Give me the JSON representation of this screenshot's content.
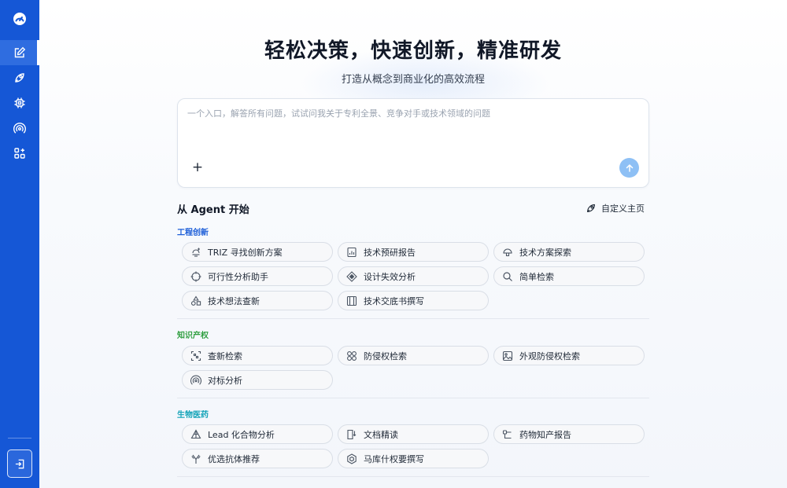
{
  "hero": {
    "title": "轻松决策，快速创新，精准研发",
    "subtitle": "打造从概念到商业化的高效流程"
  },
  "input": {
    "placeholder": "一个入口，解答所有问题，试试问我关于专利全景、竞争对手或技术领域的问题",
    "plus": "+"
  },
  "agents_header": {
    "title": "从 Agent 开始",
    "customize_label": "自定义主页"
  },
  "groups": [
    {
      "label": "工程创新",
      "color": "#1e5fd8",
      "items": [
        {
          "label": "TRIZ 寻找创新方案",
          "icon": "bulb-icon"
        },
        {
          "label": "技术预研报告",
          "icon": "chart-report-icon"
        },
        {
          "label": "技术方案探索",
          "icon": "helmet-icon"
        },
        {
          "label": "可行性分析助手",
          "icon": "target-icon"
        },
        {
          "label": "设计失效分析",
          "icon": "diamond-icon"
        },
        {
          "label": "简单检索",
          "icon": "search-icon"
        },
        {
          "label": "技术想法查新",
          "icon": "shapes-icon"
        },
        {
          "label": "技术交底书撰写",
          "icon": "book-icon"
        }
      ]
    },
    {
      "label": "知识产权",
      "color": "#2f9e3f",
      "items": [
        {
          "label": "查新检索",
          "icon": "scan-icon"
        },
        {
          "label": "防侵权检索",
          "icon": "flower-icon"
        },
        {
          "label": "外观防侵权检索",
          "icon": "image-icon"
        },
        {
          "label": "对标分析",
          "icon": "signal-icon"
        }
      ]
    },
    {
      "label": "生物医药",
      "color": "#12a3b8",
      "items": [
        {
          "label": "Lead 化合物分析",
          "icon": "molecule-icon"
        },
        {
          "label": "文档精读",
          "icon": "document-icon"
        },
        {
          "label": "药物知产报告",
          "icon": "flow-icon"
        },
        {
          "label": "优选抗体推荐",
          "icon": "antibody-icon"
        },
        {
          "label": "马库什权要撰写",
          "icon": "hexagon-icon"
        }
      ]
    }
  ],
  "colors": {
    "sidebar": "#1557d6",
    "accent": "#1e5fd8",
    "send": "#8ec0f5"
  }
}
